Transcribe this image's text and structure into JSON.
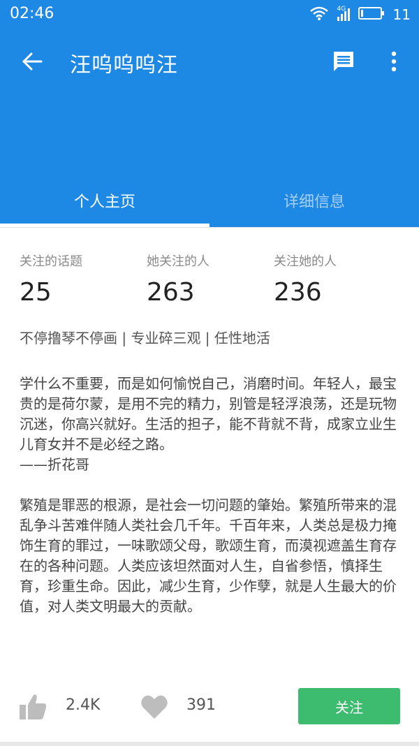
{
  "status_bar": {
    "time": "02:46",
    "network": "4G",
    "battery": "11"
  },
  "toolbar": {
    "title": "汪呜呜呜汪"
  },
  "tabs": [
    {
      "label": "个人主页",
      "active": true
    },
    {
      "label": "详细信息",
      "active": false
    }
  ],
  "stats": [
    {
      "label": "关注的话题",
      "value": "25"
    },
    {
      "label": "她关注的人",
      "value": "263"
    },
    {
      "label": "关注她的人",
      "value": "236"
    }
  ],
  "headline": "不停撸琴不停画 | 专业碎三观 | 任性地活",
  "bio": [
    "学什么不重要，而是如何愉悦自己，消磨时间。年轻人，最宝贵的是荷尔蒙，是用不完的精力，别管是轻浮浪荡，还是玩物沉迷，你高兴就好。生活的担子，能不背就不背，成家立业生儿育女并不是必经之路。\n——折花哥",
    "繁殖是罪恶的根源，是社会一切问题的肇始。繁殖所带来的混乱争斗苦难伴随人类社会几千年。千百年来，人类总是极力掩饰生育的罪过，一味歌颂父母，歌颂生育，而漠视遮盖生育存在的各种问题。人类应该坦然面对人生，自省参悟，慎择生育，珍重生命。因此，减少生育，少作孽，就是人生最大的价值，对人类文明最大的贡献。"
  ],
  "actions": {
    "likes": "2.4K",
    "thanks": "391",
    "follow_label": "关注"
  },
  "colors": {
    "primary": "#1e88e5",
    "follow": "#3dbb6f"
  },
  "icons": [
    "wifi-icon",
    "signal-icon",
    "battery-icon",
    "back-arrow-icon",
    "message-icon",
    "more-vert-icon",
    "thumbs-up-icon",
    "heart-icon"
  ]
}
